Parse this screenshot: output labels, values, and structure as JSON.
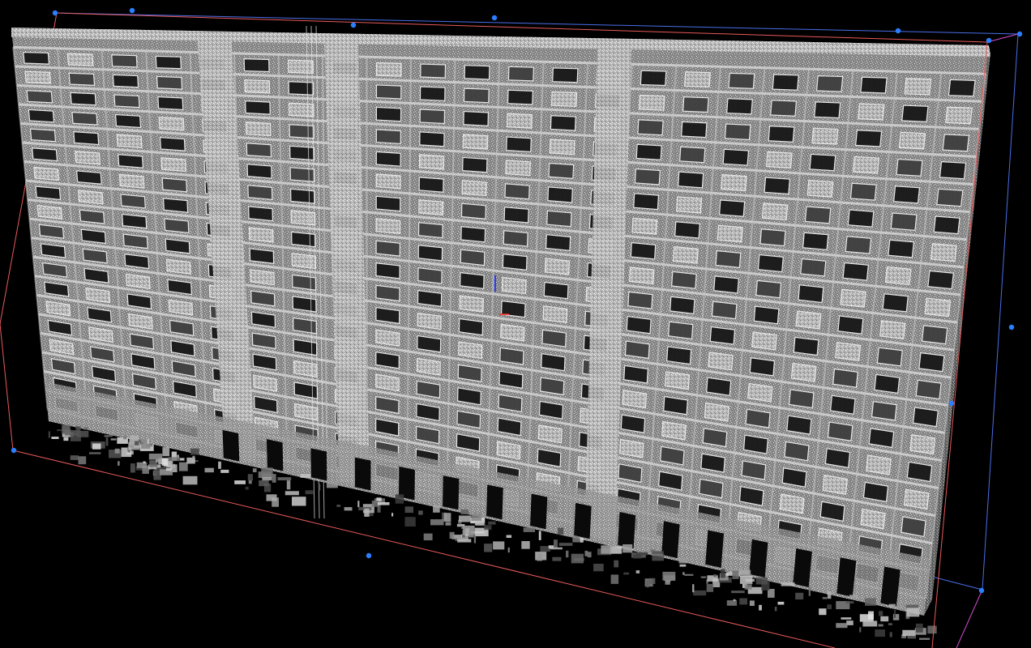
{
  "viewer": {
    "background_color": "#000000",
    "cloud_colormap": "grayscale",
    "bbox_edge_colors": {
      "front": "#e85a5a",
      "back": "#4a6ee8",
      "side": "#d24fd2"
    },
    "handle_color": "#2a7fff",
    "building": {
      "floors": 19,
      "window_bays": 22,
      "core_columns": 3
    },
    "gizmo_colors": {
      "z_axis": "#2a3cff",
      "x_axis": "#ff2a2a"
    }
  }
}
